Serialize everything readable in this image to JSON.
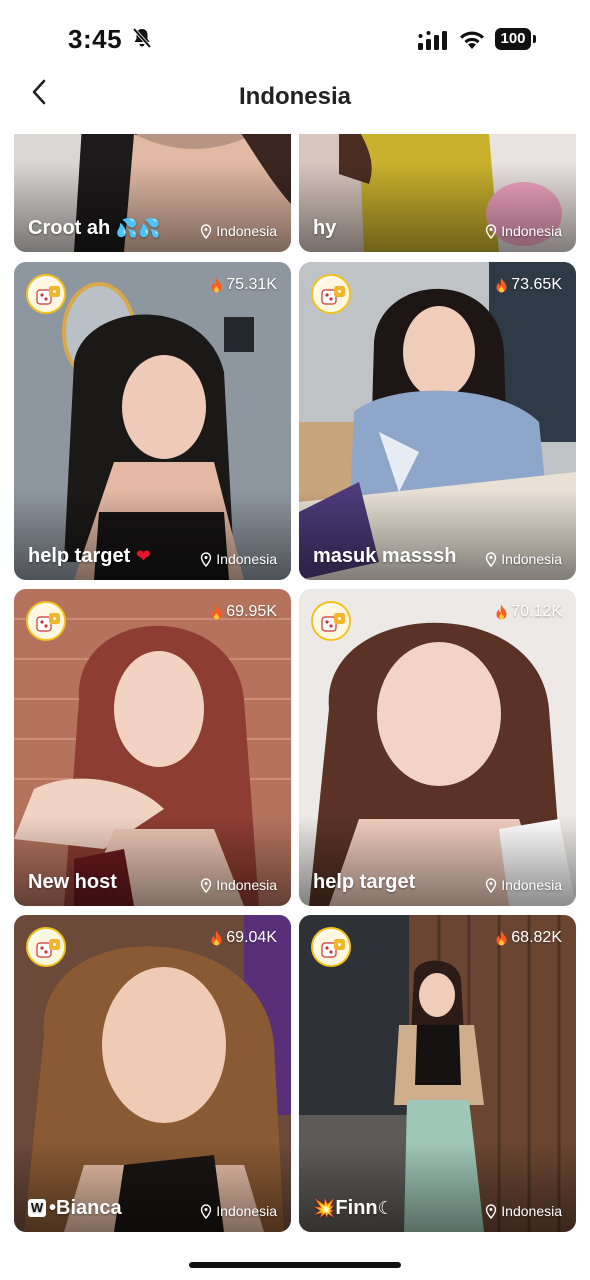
{
  "status_bar": {
    "time": "3:45",
    "battery": "100"
  },
  "nav": {
    "title": "Indonesia"
  },
  "colors": {
    "badge_ring": "#f6c21a",
    "flame": "#ff5a1f",
    "heart": "#e5162b"
  },
  "cards": [
    {
      "name": "Croot ah",
      "name_icon": "💦💦",
      "location": "Indonesia",
      "viewers": ""
    },
    {
      "name": "hy",
      "location": "Indonesia",
      "viewers": ""
    },
    {
      "name": "help target",
      "name_icon": "❤",
      "location": "Indonesia",
      "viewers": "75.31K"
    },
    {
      "name": "masuk masssh",
      "location": "Indonesia",
      "viewers": "73.65K"
    },
    {
      "name": "New host",
      "location": "Indonesia",
      "viewers": "69.95K"
    },
    {
      "name": "help target",
      "location": "Indonesia",
      "viewers": "70.12K"
    },
    {
      "name_prefix": "W",
      "name": "•Bianca",
      "location": "Indonesia",
      "viewers": "69.04K"
    },
    {
      "name_prefix_icon": "💥",
      "name": "Finn",
      "name_icon": "☾",
      "location": "Indonesia",
      "viewers": "68.82K"
    }
  ]
}
